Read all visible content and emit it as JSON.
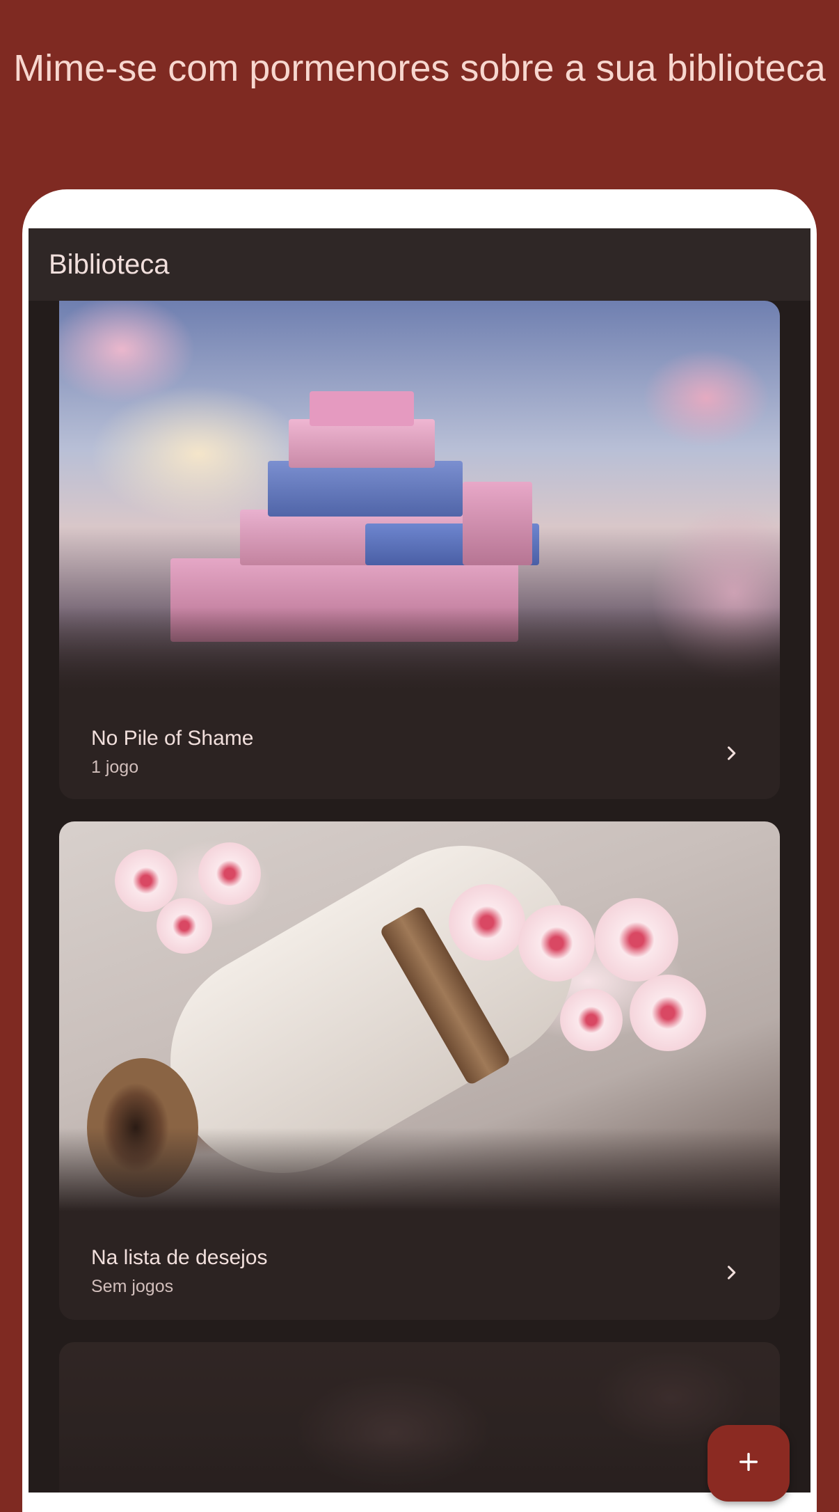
{
  "header": {
    "headline": "Mime-se com pormenores sobre a sua biblioteca"
  },
  "appbar": {
    "title": "Biblioteca"
  },
  "cards": [
    {
      "title": "No Pile of Shame",
      "subtitle": "1 jogo",
      "image": "pile-of-game-boxes-cherry-blossoms"
    },
    {
      "title": "Na lista de desejos",
      "subtitle": "Sem jogos",
      "image": "parchment-scroll-cherry-blossoms"
    },
    {
      "title": "",
      "subtitle": "",
      "image": "cherry-blossoms-dimmed"
    }
  ],
  "fab": {
    "icon": "plus-icon"
  },
  "colors": {
    "background": "#7f2a22",
    "headline": "#f7d7cf",
    "surface": "#231c1b",
    "appbar": "#2f2726",
    "card": "#2c2322",
    "fab": "#8b2a22"
  }
}
